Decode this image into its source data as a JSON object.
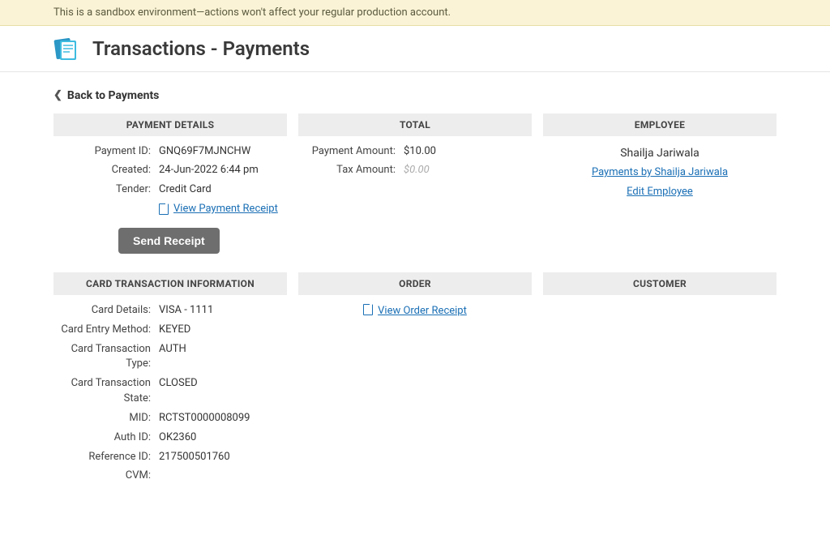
{
  "sandbox_notice": "This is a sandbox environment—actions won't affect your regular production account.",
  "page_title": "Transactions - Payments",
  "back_link": "Back to Payments",
  "sections": {
    "payment_details": {
      "header": "PAYMENT DETAILS",
      "payment_id_label": "Payment ID:",
      "payment_id": "GNQ69F7MJNCHW",
      "created_label": "Created:",
      "created": "24-Jun-2022 6:44 pm",
      "tender_label": "Tender:",
      "tender": "Credit Card",
      "view_receipt": "View Payment Receipt",
      "send_receipt_btn": "Send Receipt"
    },
    "total": {
      "header": "TOTAL",
      "payment_amount_label": "Payment Amount:",
      "payment_amount": "$10.00",
      "tax_amount_label": "Tax Amount:",
      "tax_amount": "$0.00"
    },
    "employee": {
      "header": "EMPLOYEE",
      "name": "Shailja Jariwala",
      "payments_link": "Payments by Shailja Jariwala",
      "edit_link": "Edit Employee"
    },
    "card_txn": {
      "header": "CARD TRANSACTION INFORMATION",
      "card_details_label": "Card Details:",
      "card_details": "VISA - 1111",
      "entry_method_label": "Card Entry Method:",
      "entry_method": "KEYED",
      "txn_type_label": "Card Transaction Type:",
      "txn_type": "AUTH",
      "txn_state_label": "Card Transaction State:",
      "txn_state": "CLOSED",
      "mid_label": "MID:",
      "mid": "RCTST0000008099",
      "auth_id_label": "Auth ID:",
      "auth_id": "OK2360",
      "ref_id_label": "Reference ID:",
      "ref_id": "217500501760",
      "cvm_label": "CVM:",
      "cvm": ""
    },
    "order": {
      "header": "ORDER",
      "view_receipt": "View Order Receipt"
    },
    "customer": {
      "header": "CUSTOMER"
    }
  }
}
